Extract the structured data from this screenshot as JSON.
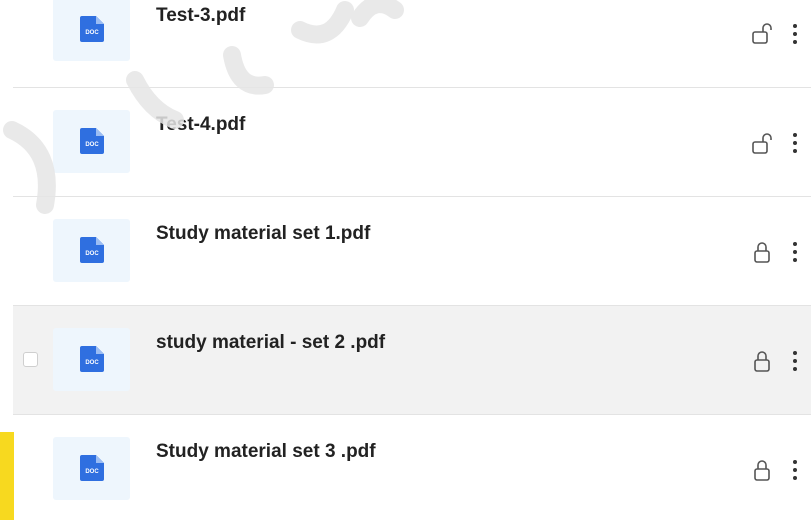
{
  "files": [
    {
      "name": "Test-3.pdf",
      "locked": false,
      "selected": false
    },
    {
      "name": "Test-4.pdf",
      "locked": false,
      "selected": false
    },
    {
      "name": "Study material set 1.pdf",
      "locked": true,
      "selected": false
    },
    {
      "name": "study material - set 2 .pdf",
      "locked": true,
      "selected": true
    },
    {
      "name": "Study material set 3 .pdf",
      "locked": true,
      "selected": false
    }
  ],
  "icons": {
    "file": "doc-file-icon",
    "unlocked": "unlock-icon",
    "locked": "lock-icon",
    "more": "more-vertical-icon"
  },
  "doc_label": "DOC",
  "colors": {
    "doc_blue": "#2f6fe0",
    "thumb_bg": "#eef6fd",
    "selected_row": "#f2f2f2",
    "accent_yellow": "#f7d91f"
  }
}
